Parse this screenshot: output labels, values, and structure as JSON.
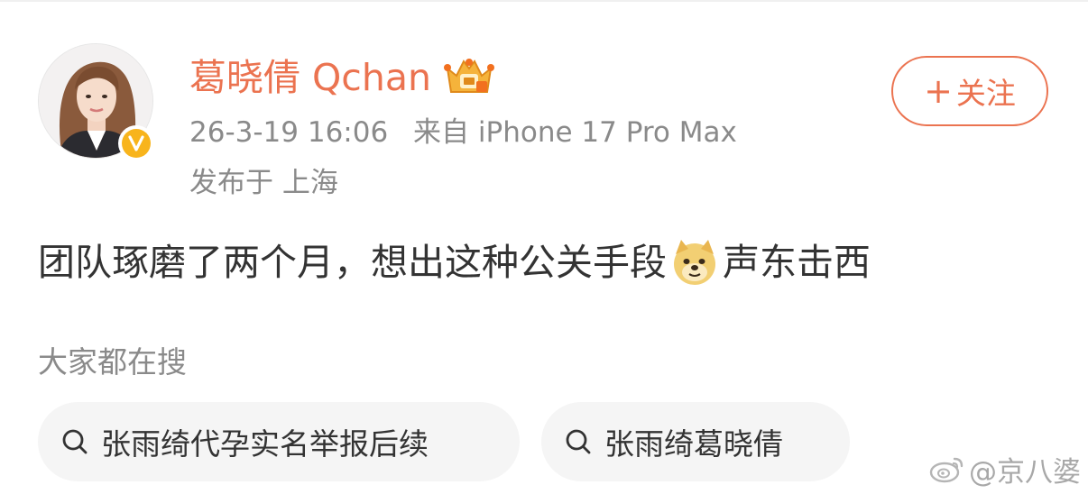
{
  "post": {
    "author": {
      "name": "葛晓倩 Qchan",
      "verified_badge": "V",
      "member_icon": "crown-icon"
    },
    "timestamp": "26-3-19 16:06",
    "source": "来自 iPhone 17 Pro Max",
    "location": "发布于 上海",
    "follow_label": "关注",
    "content": {
      "text_before": "团队琢磨了两个月，想出这种公关手段",
      "emoji": "doge-emoji",
      "text_after": "声东击西"
    }
  },
  "search": {
    "title": "大家都在搜",
    "chips": [
      {
        "label": "张雨绮代孕实名举报后续"
      },
      {
        "label": "张雨绮葛晓倩"
      }
    ]
  },
  "watermark": {
    "text": "@京八婆"
  },
  "colors": {
    "accent": "#eb7350",
    "meta_text": "#8a8a8a",
    "body_text": "#333333",
    "chip_bg": "#f5f5f5",
    "verified": "#f8b41c"
  }
}
